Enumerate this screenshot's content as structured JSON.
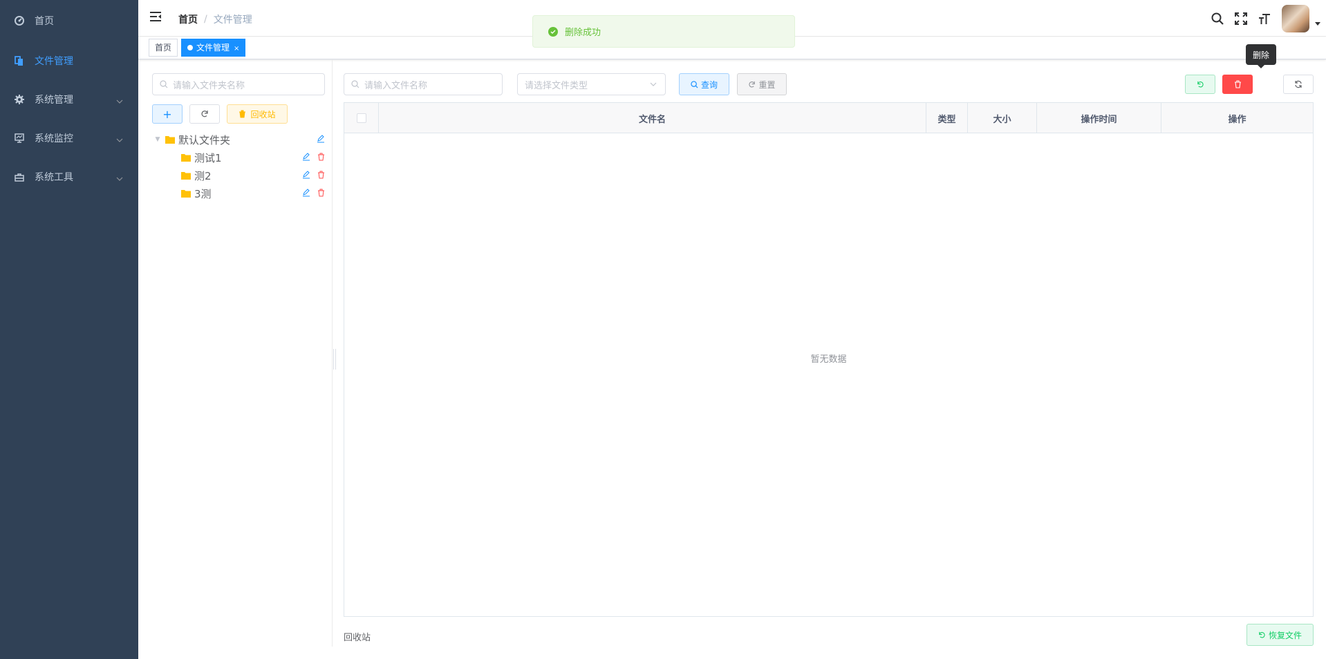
{
  "sidebar": {
    "items": [
      {
        "label": "首页"
      },
      {
        "label": "文件管理"
      },
      {
        "label": "系统管理"
      },
      {
        "label": "系统监控"
      },
      {
        "label": "系统工具"
      }
    ]
  },
  "navbar": {
    "breadcrumb_home": "首页",
    "breadcrumb_sep": "/",
    "breadcrumb_current": "文件管理"
  },
  "tags": {
    "home": "首页",
    "current": "文件管理",
    "close": "×"
  },
  "toast": {
    "message": "删除成功"
  },
  "folder_panel": {
    "search_placeholder": "请输入文件夹名称",
    "add_label": "+",
    "recycle_label": "回收站",
    "tree": {
      "root": "默认文件夹",
      "children": [
        {
          "label": "测试1"
        },
        {
          "label": "测2"
        },
        {
          "label": "3测"
        }
      ]
    }
  },
  "file_panel": {
    "search_placeholder": "请输入文件名称",
    "type_placeholder": "请选择文件类型",
    "query_label": "查询",
    "reset_label": "重置",
    "tooltip": "删除",
    "columns": [
      "文件名",
      "类型",
      "大小",
      "操作时间",
      "操作"
    ],
    "empty_text": "暂无数据",
    "recycle_label": "回收站",
    "restore_label": "恢复文件"
  },
  "colors": {
    "sidebar_bg": "#304156",
    "active": "#409eff",
    "success": "#67c23a",
    "danger": "#ff4949",
    "warning": "#ffba00"
  }
}
